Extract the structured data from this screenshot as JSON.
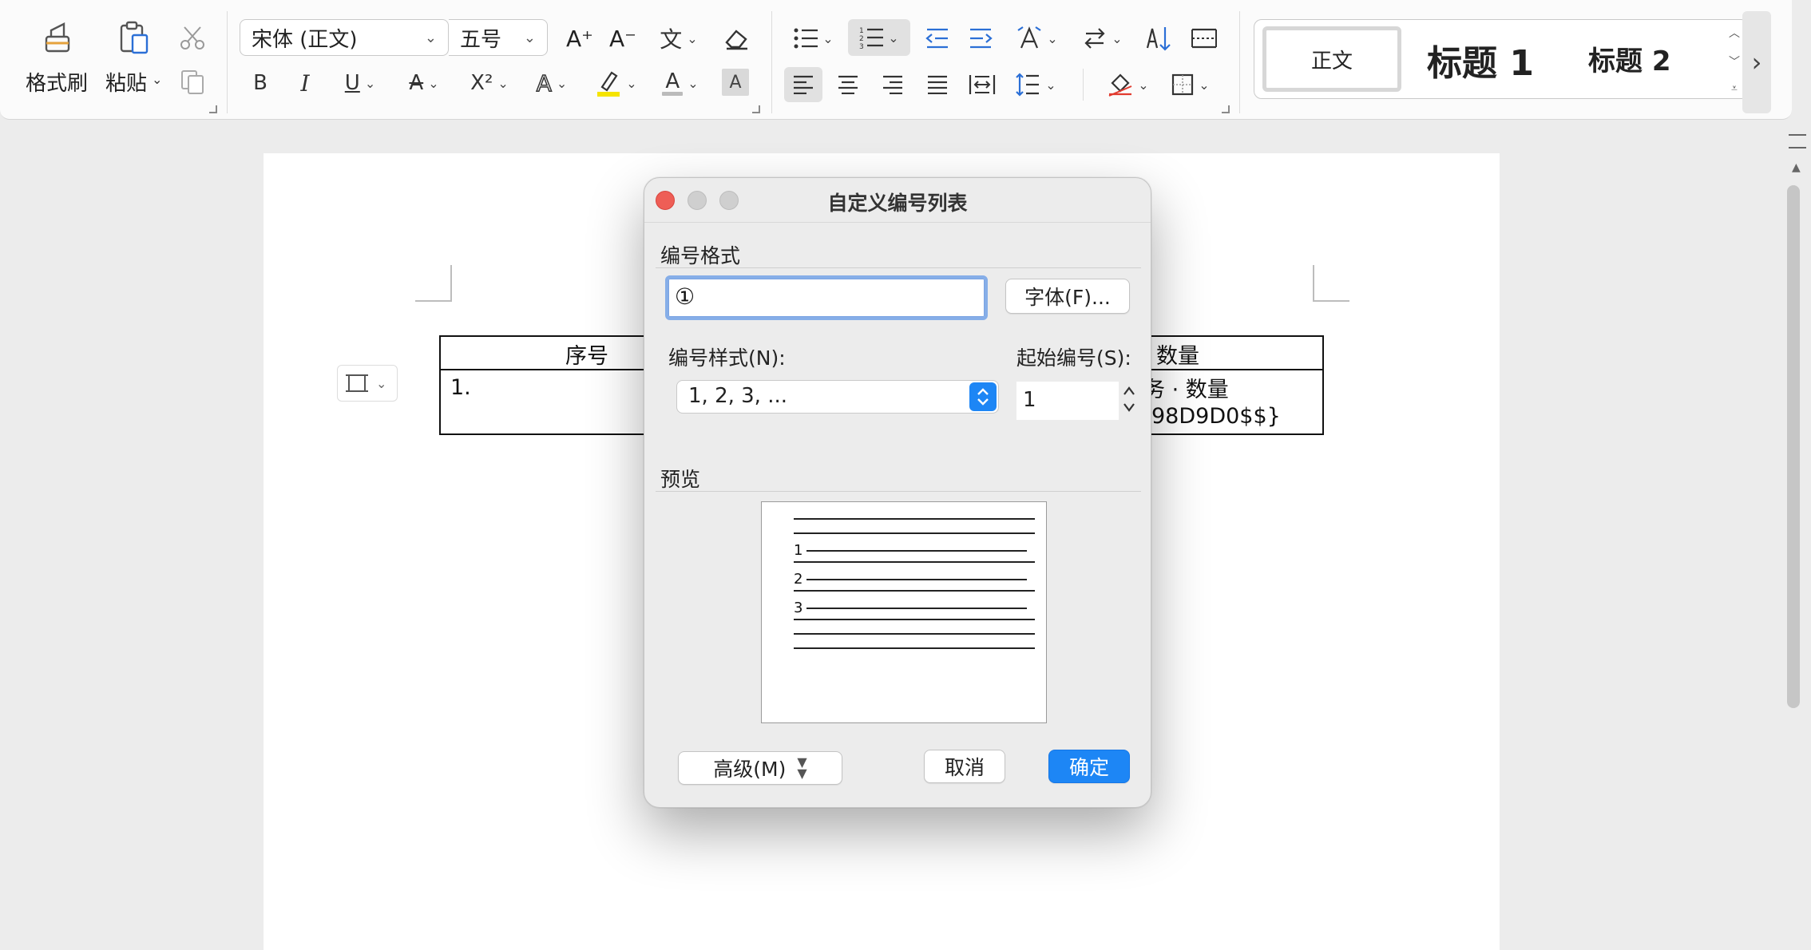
{
  "ribbon": {
    "format_painter_label": "格式刷",
    "paste_label": "粘贴",
    "font_name": "宋体 (正文)",
    "font_size": "五号",
    "bold": "B",
    "italic": "I",
    "underline": "U",
    "strikethrough": "A",
    "superscript": "X²",
    "font_color_glyph": "A",
    "char_shading_glyph": "A",
    "increase_font": "A⁺",
    "decrease_font": "A⁻",
    "phonetic_glyph": "文",
    "styles": {
      "normal": "正文",
      "heading1": "标题 1",
      "heading2": "标题 2"
    }
  },
  "document": {
    "table_headers": {
      "col1": "序号",
      "col4": "数量"
    },
    "row1": {
      "col1": "1.",
      "col4_line1": "务 · 数量",
      "col4_line2": "98D9D0$$}"
    }
  },
  "dialog": {
    "title": "自定义编号列表",
    "number_format_label": "编号格式",
    "number_format_value": "①",
    "font_button": "字体(F)...",
    "number_style_label": "编号样式(N):",
    "number_style_value": "1, 2, 3, ...",
    "start_at_label": "起始编号(S):",
    "start_at_value": "1",
    "preview_label": "预览",
    "preview_numbers": [
      "1",
      "2",
      "3"
    ],
    "advanced_button": "高级(M)",
    "cancel_button": "取消",
    "ok_button": "确定"
  },
  "colors": {
    "accent": "#1d86f5",
    "close": "#ee5e56",
    "traffic_inactive": "#cfcfcf",
    "highlight_yellow": "#f5e400"
  }
}
